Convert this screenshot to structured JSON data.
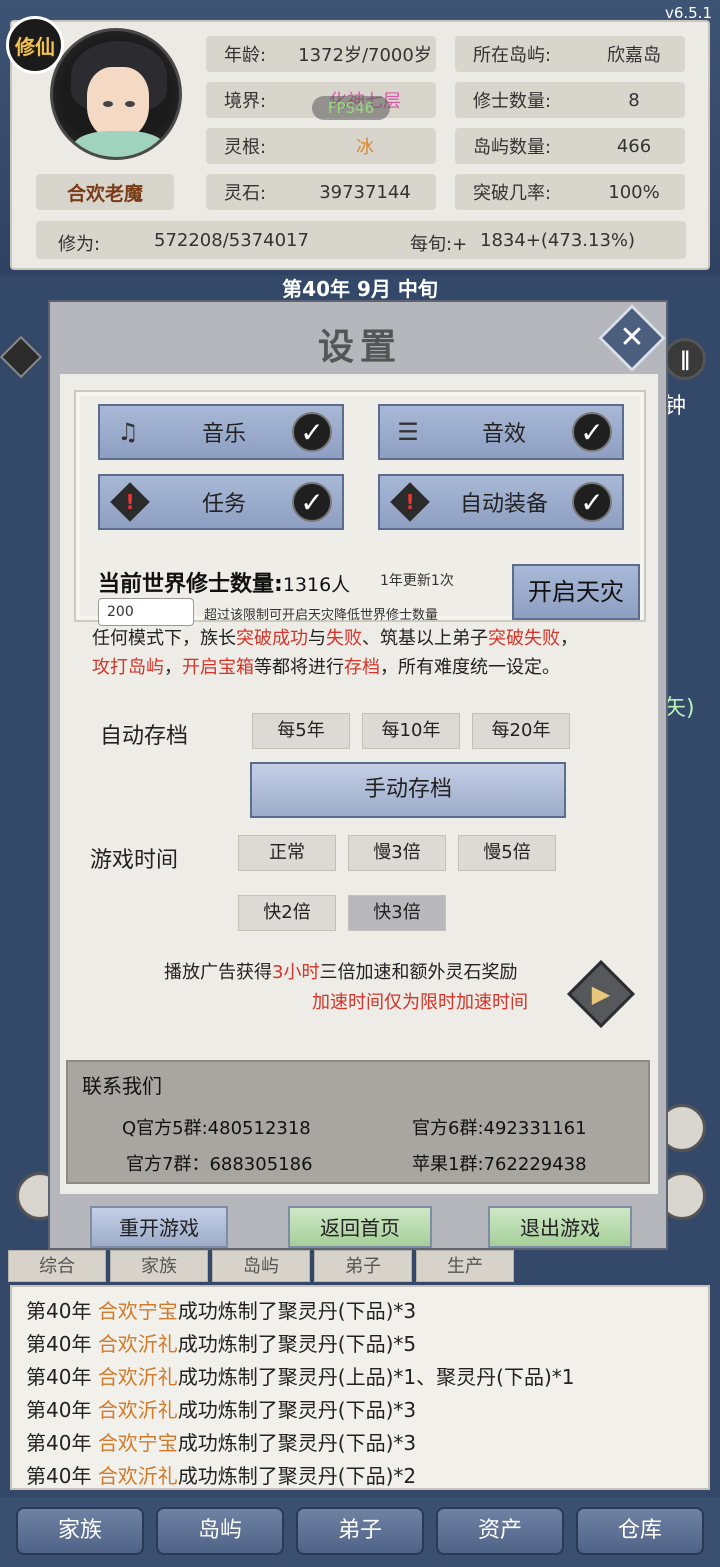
{
  "version": "v6.5.1",
  "fps": "FPS46",
  "player": {
    "badge": "修仙",
    "name": "合欢老魔"
  },
  "stats": {
    "age_label": "年龄:",
    "age_value": "1372岁/7000岁",
    "realm_label": "境界:",
    "realm_value": "化神七层",
    "root_label": "灵根:",
    "root_value": "冰",
    "stone_label": "灵石:",
    "stone_value": "39737144",
    "island_label": "所在岛屿:",
    "island_value": "欣嘉岛",
    "cultivators_label": "修士数量:",
    "cultivators_value": "8",
    "islands_label": "岛屿数量:",
    "islands_value": "466",
    "breakthrough_label": "突破几率:",
    "breakthrough_value": "100%",
    "cultivation_label": "修为:",
    "cultivation_value": "572208/5374017",
    "per_tenday_label": "每旬:+",
    "per_tenday_value": "1834+(473.13%)"
  },
  "date": "第40年 9月 中旬",
  "side": {
    "right_text_1": "钟",
    "right_text_2": "矢)"
  },
  "dialog": {
    "title": "设置",
    "toggles": {
      "music": "音乐",
      "sfx": "音效",
      "task": "任务",
      "auto_equip": "自动装备"
    },
    "world_count_label": "当前世界修士数量:",
    "world_count_value": "1316人",
    "update_note": "1年更新1次",
    "limit_value": "200",
    "limit_hint": "超过该限制可开启天灾降低世界修士数量",
    "disaster_button": "开启天灾",
    "save_note": {
      "p1": "任何模式下，族长",
      "r1": "突破成功",
      "p2": "与",
      "r2": "失败",
      "p3": "、筑基以上弟子",
      "r3": "突破失败",
      "p4": "，",
      "r4": "攻打岛屿",
      "p5": "，",
      "r5": "开启宝箱",
      "p6": "等都将进行",
      "r6": "存档",
      "p7": "，所有难度统一设定。"
    },
    "auto_save_label": "自动存档",
    "auto_save_options": [
      "每5年",
      "每10年",
      "每20年"
    ],
    "manual_save": "手动存档",
    "game_time_label": "游戏时间",
    "game_time_options": [
      "正常",
      "慢3倍",
      "慢5倍",
      "快2倍",
      "快3倍"
    ],
    "ad_text": {
      "a": "播放广告获得",
      "b": "3小时",
      "c": "三倍加速和额外灵石奖励",
      "d": "加速时间仅为限时加速时间"
    },
    "contact": {
      "title": "联系我们",
      "q5": "Q官方5群:480512318",
      "g6": "官方6群:492331161",
      "g7": "官方7群：688305186",
      "apple1": "苹果1群:762229438"
    },
    "restart": "重开游戏",
    "home": "返回首页",
    "exit": "退出游戏"
  },
  "log": {
    "tabs": [
      "综合",
      "家族",
      "岛屿",
      "弟子",
      "生产"
    ],
    "rows": [
      {
        "year": "第40年",
        "who": "合欢宁宝",
        "text": "成功炼制了聚灵丹(下品)*3"
      },
      {
        "year": "第40年",
        "who": "合欢沂礼",
        "text": "成功炼制了聚灵丹(下品)*5"
      },
      {
        "year": "第40年",
        "who": "合欢沂礼",
        "text": "成功炼制了聚灵丹(上品)*1、聚灵丹(下品)*1"
      },
      {
        "year": "第40年",
        "who": "合欢沂礼",
        "text": "成功炼制了聚灵丹(下品)*3"
      },
      {
        "year": "第40年",
        "who": "合欢宁宝",
        "text": "成功炼制了聚灵丹(下品)*3"
      },
      {
        "year": "第40年",
        "who": "合欢沂礼",
        "text": "成功炼制了聚灵丹(下品)*2"
      }
    ]
  },
  "nav": [
    "家族",
    "岛屿",
    "弟子",
    "资产",
    "仓库"
  ],
  "colors": {
    "accent_red": "#d4342a",
    "name_orange": "#d07a2a",
    "panel_blue": "#34496a"
  }
}
